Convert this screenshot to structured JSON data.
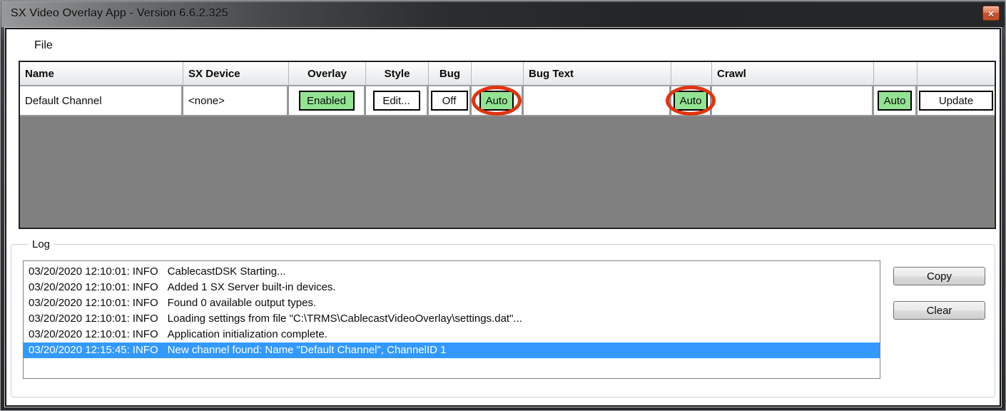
{
  "window": {
    "title": "SX Video Overlay App - Version 6.6.2.325",
    "close_glyph": "×"
  },
  "menu": {
    "items": [
      {
        "label": "File"
      }
    ]
  },
  "channels_table": {
    "headers": [
      "Name",
      "SX Device",
      "Overlay",
      "Style",
      "Bug",
      "",
      "Bug Text",
      "",
      "Crawl",
      "",
      ""
    ],
    "rows": [
      {
        "name": "Default Channel",
        "sx_device": "<none>",
        "overlay_state": "Enabled",
        "style_button": "Edit...",
        "bug_state": "Off",
        "bug_auto": "Auto",
        "bug_text_value": "",
        "bug_text_auto": "Auto",
        "crawl_value": "",
        "crawl_auto": "Auto",
        "update_button": "Update"
      }
    ]
  },
  "annotations": {
    "note": "red ellipses drawn around the Bug Auto and Bug Text Auto buttons"
  },
  "log": {
    "group_label": "Log",
    "entries": [
      {
        "timestamp": "03/20/2020 12:10:01:",
        "level": "INFO",
        "message": "CablecastDSK Starting...",
        "selected": false
      },
      {
        "timestamp": "03/20/2020 12:10:01:",
        "level": "INFO",
        "message": "Added 1 SX Server built-in devices.",
        "selected": false
      },
      {
        "timestamp": "03/20/2020 12:10:01:",
        "level": "INFO",
        "message": "Found 0 available output types.",
        "selected": false
      },
      {
        "timestamp": "03/20/2020 12:10:01:",
        "level": "INFO",
        "message": "Loading settings from file \"C:\\TRMS\\CablecastVideoOverlay\\settings.dat\"...",
        "selected": false
      },
      {
        "timestamp": "03/20/2020 12:10:01:",
        "level": "INFO",
        "message": "Application initialization complete.",
        "selected": false
      },
      {
        "timestamp": "03/20/2020 12:15:45:",
        "level": "INFO",
        "message": "New channel found: Name \"Default Channel\", ChannelID 1",
        "selected": true
      }
    ],
    "copy_button": "Copy",
    "clear_button": "Clear"
  },
  "colors": {
    "enabled_green": "#92e492",
    "annotation_red": "#e2330f",
    "selection_blue": "#3399ff",
    "table_empty_gray": "#808080"
  }
}
